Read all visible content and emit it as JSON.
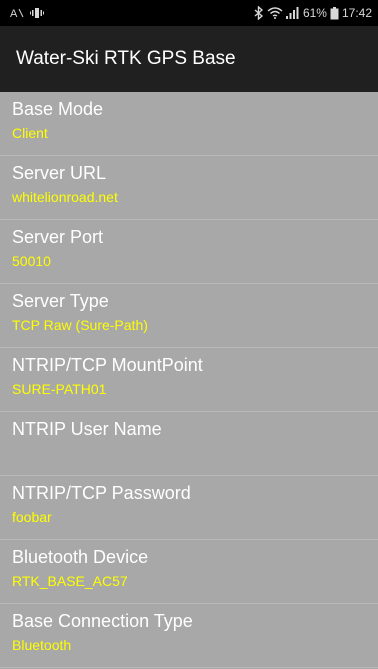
{
  "status_bar": {
    "carrier_icon": "A⁄",
    "bluetooth_icon": "bluetooth-icon",
    "signal": "…ıl",
    "battery_percent": "61%",
    "time": "17:42"
  },
  "app_bar": {
    "title": "Water-Ski RTK GPS Base"
  },
  "preferences": [
    {
      "title": "Base Mode",
      "summary": "Client"
    },
    {
      "title": "Server URL",
      "summary": "whitelionroad.net"
    },
    {
      "title": "Server Port",
      "summary": "50010"
    },
    {
      "title": "Server Type",
      "summary": "TCP Raw (Sure-Path)"
    },
    {
      "title": "NTRIP/TCP MountPoint",
      "summary": "SURE-PATH01"
    },
    {
      "title": "NTRIP User Name",
      "summary": ""
    },
    {
      "title": "NTRIP/TCP Password",
      "summary": "foobar"
    },
    {
      "title": "Bluetooth Device",
      "summary": "RTK_BASE_AC57"
    },
    {
      "title": "Base Connection Type",
      "summary": "Bluetooth"
    }
  ],
  "colors": {
    "status_bar_bg": "#000000",
    "app_bar_bg": "#202020",
    "list_bg": "#a8a8a8",
    "title_text": "#ffffff",
    "summary_text": "#ffff00"
  }
}
